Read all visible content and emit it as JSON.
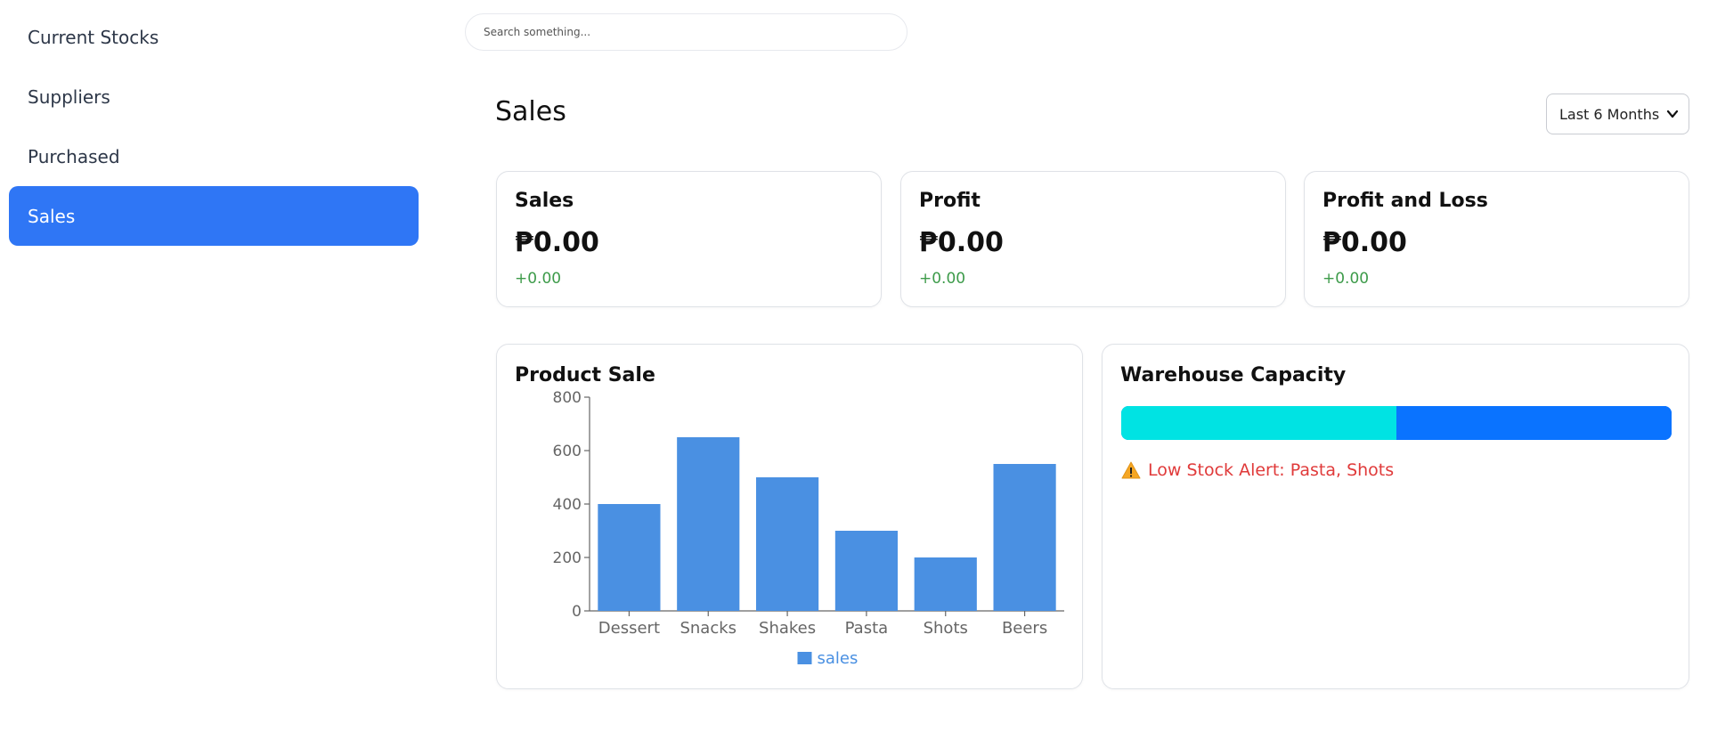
{
  "sidebar": {
    "items": [
      {
        "label": "Current Stocks",
        "active": false
      },
      {
        "label": "Suppliers",
        "active": false
      },
      {
        "label": "Purchased",
        "active": false
      },
      {
        "label": "Sales",
        "active": true
      }
    ]
  },
  "search": {
    "placeholder": "Search something..."
  },
  "page": {
    "title": "Sales"
  },
  "range": {
    "selected": "Last 6 Months"
  },
  "stats": [
    {
      "label": "Sales",
      "value": "₱0.00",
      "delta": "+0.00"
    },
    {
      "label": "Profit",
      "value": "₱0.00",
      "delta": "+0.00"
    },
    {
      "label": "Profit and Loss",
      "value": "₱0.00",
      "delta": "+0.00"
    }
  ],
  "product_sale": {
    "title": "Product Sale"
  },
  "chart_data": {
    "type": "bar",
    "title": "Product Sale",
    "categories": [
      "Dessert",
      "Snacks",
      "Shakes",
      "Pasta",
      "Shots",
      "Beers"
    ],
    "series": [
      {
        "name": "sales",
        "values": [
          400,
          650,
          500,
          300,
          200,
          550
        ]
      }
    ],
    "ylim": [
      0,
      800
    ],
    "yticks": [
      0,
      200,
      400,
      600,
      800
    ],
    "grid": false,
    "legend": "bottom",
    "color": "#4a90e2"
  },
  "warehouse": {
    "title": "Warehouse Capacity",
    "used_fraction": 0.5,
    "used_color": "#00e3e3",
    "free_color": "#0a73ff",
    "alert_text": "Low Stock Alert: Pasta, Shots",
    "alert_icon": "warning-icon"
  }
}
